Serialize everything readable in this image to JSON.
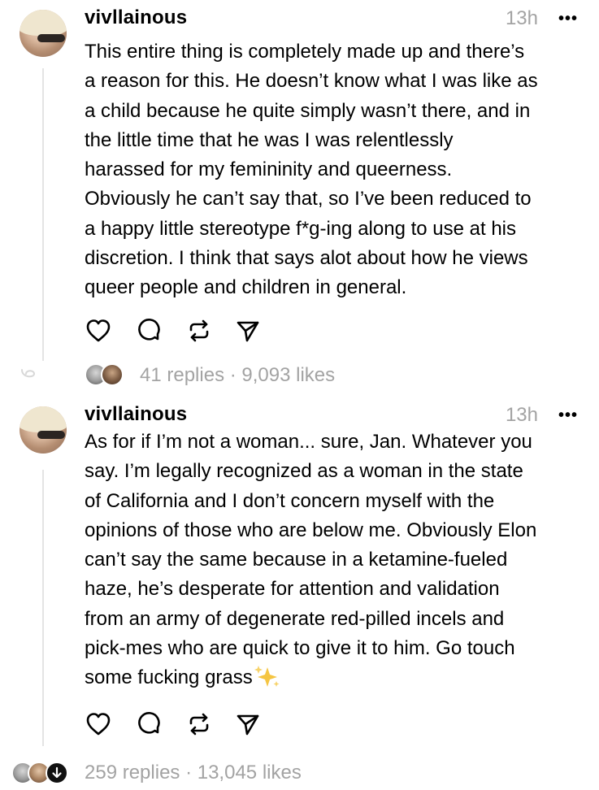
{
  "posts": [
    {
      "username": "vivllainous",
      "time": "13h",
      "more": "•••",
      "text": "This entire thing is completely made up and there’s\na reason for this. He doesn’t know what I was like as\na child because he quite simply wasn’t there, and in\nthe little time that he was I was relentlessly\nharassed for my femininity and queerness.\nObviously he can’t say that, so I’ve been reduced to\na happy little stereotype f*g-ing along to use at his\ndiscretion. I think that says alot about how he views\nqueer people and children in general.",
      "stats": "41 replies · 9,093 likes"
    },
    {
      "username": "vivllainous",
      "time": "13h",
      "more": "•••",
      "text": "As for if I’m not a woman... sure, Jan. Whatever you\nsay. I’m legally recognized as a woman in the state\nof California and I don’t concern myself with the\nopinions of those who are below me. Obviously Elon\ncan’t say the same because in a ketamine-fueled\nhaze, he’s desperate for attention and validation\nfrom an army of degenerate red-pilled incels and\npick-mes who are quick to give it to him. Go touch\nsome fucking grass",
      "stats": "259 replies · 13,045 likes"
    }
  ],
  "icons": {
    "like": "heart-icon",
    "reply": "comment-bubble-icon",
    "repost": "repost-icon",
    "share": "send-icon",
    "sparkles": "sparkles-emoji"
  },
  "colors": {
    "text": "#000000",
    "muted": "#a3a3a3",
    "thread_line": "#e4e4e4",
    "sparkle": "#f5c542"
  }
}
